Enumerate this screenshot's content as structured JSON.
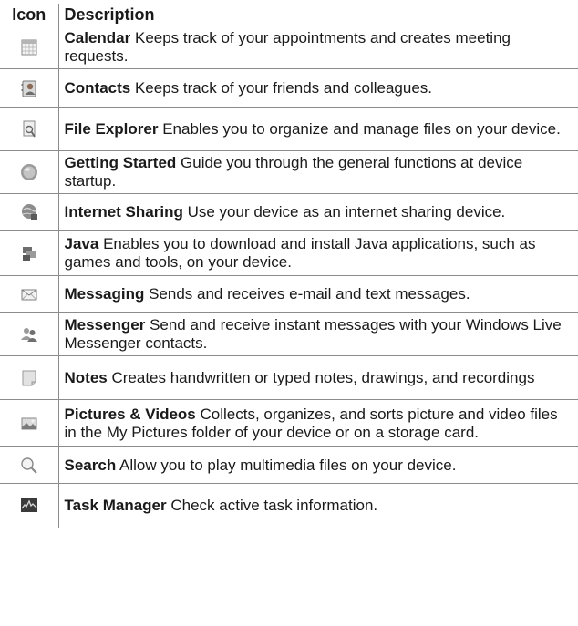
{
  "table": {
    "headers": [
      "Icon",
      "Description"
    ],
    "rows": [
      {
        "icon": "calendar-icon",
        "name": "Calendar",
        "text": "Keeps track of your appointments and creates meeting requests."
      },
      {
        "icon": "contacts-icon",
        "name": "Contacts",
        "text": "Keeps track of your friends and colleagues."
      },
      {
        "icon": "file-explorer-icon",
        "name": "File Explorer",
        "text": "Enables you to organize and manage files on your device."
      },
      {
        "icon": "getting-started-icon",
        "name": "Getting Started",
        "text": "Guide you through the general functions at device startup."
      },
      {
        "icon": "internet-sharing-icon",
        "name": "Internet Sharing",
        "text": "Use your device as an internet sharing device."
      },
      {
        "icon": "java-icon",
        "name": "Java",
        "text": "Enables you to download and install Java applications, such as games and tools, on your device."
      },
      {
        "icon": "messaging-icon",
        "name": "Messaging",
        "text": "Sends and receives e-mail and text messages."
      },
      {
        "icon": "messenger-icon",
        "name": "Messenger",
        "text": "Send and receive instant messages with your Windows Live Messenger contacts."
      },
      {
        "icon": "notes-icon",
        "name": "Notes",
        "text": "Creates handwritten or typed notes, drawings, and recordings"
      },
      {
        "icon": "pictures-videos-icon",
        "name": "Pictures & Videos",
        "text": "Collects, organizes, and sorts picture and video files in the My Pictures folder of your device or on a storage card."
      },
      {
        "icon": "search-icon",
        "name": "Search",
        "text": "Allow you to play multimedia files on your device."
      },
      {
        "icon": "task-manager-icon",
        "name": "Task Manager",
        "text": "Check active task information."
      }
    ]
  }
}
